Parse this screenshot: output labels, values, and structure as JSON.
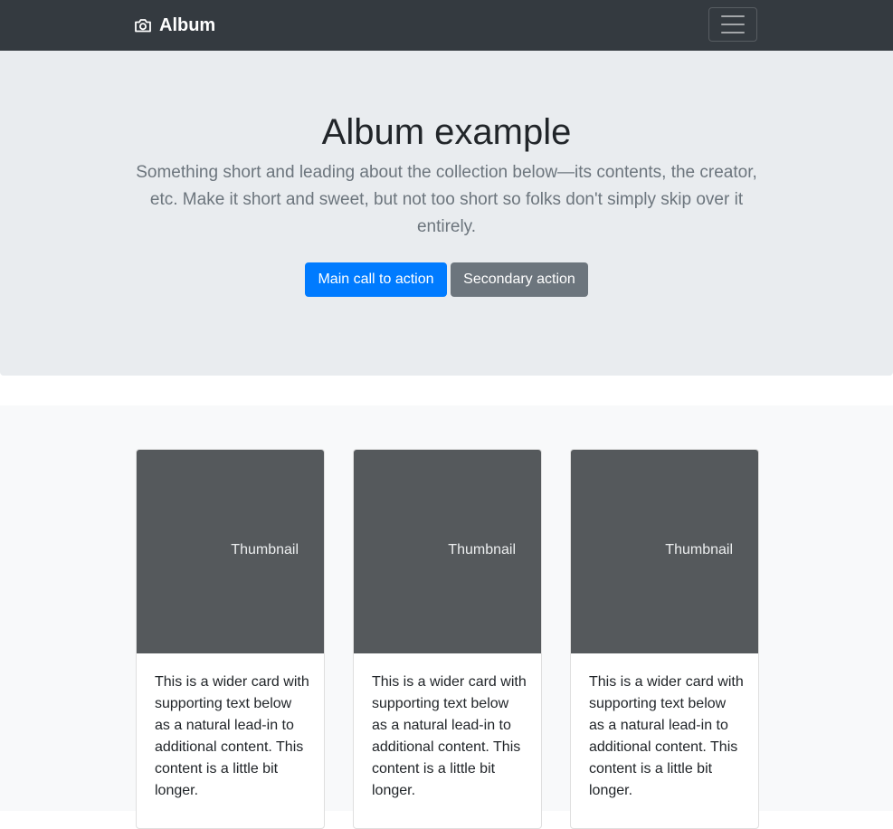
{
  "navbar": {
    "brand": "Album",
    "brand_icon": "camera-icon",
    "toggler_icon": "hamburger-menu-icon",
    "background": "#343a40"
  },
  "jumbotron": {
    "title": "Album example",
    "lead": "Something short and leading about the collection below—its contents, the creator, etc. Make it short and sweet, but not too short so folks don't simply skip over it entirely.",
    "primary_action": "Main call to action",
    "secondary_action": "Secondary action",
    "background": "#e9ecef"
  },
  "colors": {
    "primary": "#007bff",
    "secondary": "#6c757d",
    "thumbnail": "#55595c"
  },
  "cards": [
    {
      "thumbnail_label": "Thumbnail",
      "text": "This is a wider card with supporting text below as a natural lead-in to additional content. This content is a little bit longer."
    },
    {
      "thumbnail_label": "Thumbnail",
      "text": "This is a wider card with supporting text below as a natural lead-in to additional content. This content is a little bit longer."
    },
    {
      "thumbnail_label": "Thumbnail",
      "text": "This is a wider card with supporting text below as a natural lead-in to additional content. This content is a little bit longer."
    }
  ]
}
